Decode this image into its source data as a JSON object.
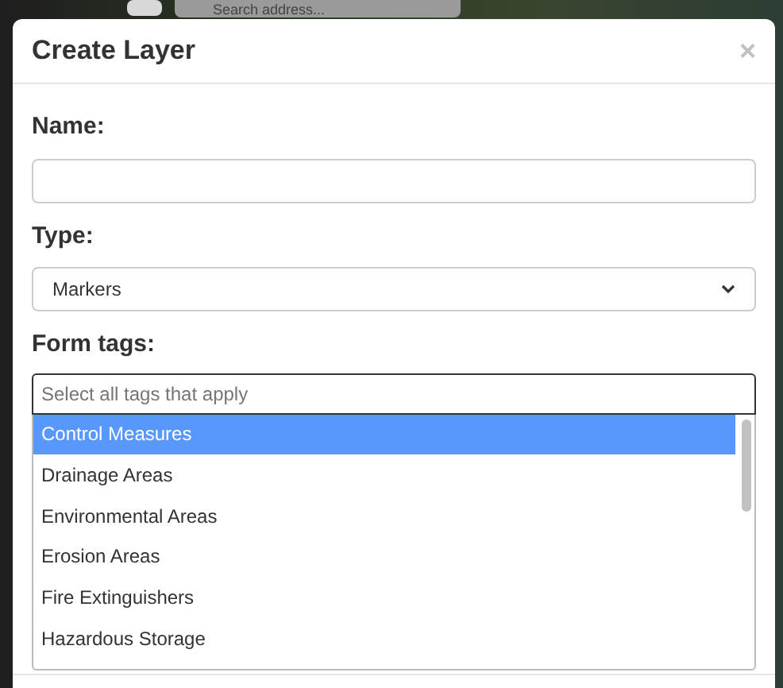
{
  "map": {
    "search": {
      "placeholder": "Search address..."
    }
  },
  "dialog": {
    "title": "Create Layer",
    "close": "×",
    "name": {
      "label": "Name:"
    },
    "type": {
      "label": "Type:",
      "value": "Markers"
    },
    "form_tags": {
      "label": "Form tags:",
      "placeholder": "Select all tags that apply",
      "options": [
        {
          "label": "Control Measures",
          "selected": true
        },
        {
          "label": "Drainage Areas",
          "selected": false
        },
        {
          "label": "Environmental Areas",
          "selected": false
        },
        {
          "label": "Erosion Areas",
          "selected": false
        },
        {
          "label": "Fire Extinguishers",
          "selected": false
        },
        {
          "label": "Hazardous Storage",
          "selected": false
        }
      ]
    }
  }
}
